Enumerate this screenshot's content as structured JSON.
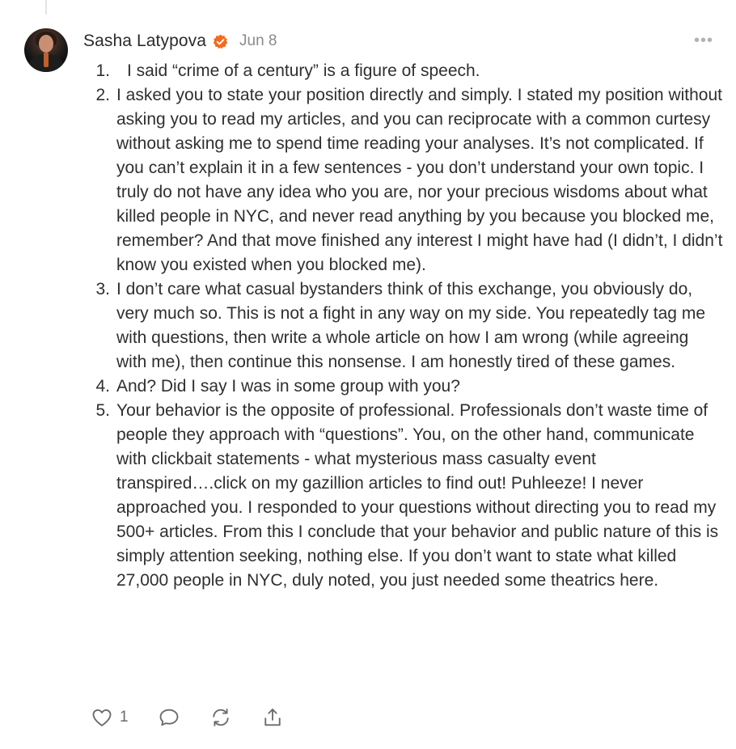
{
  "comment": {
    "author": "Sasha Latypova",
    "date": "Jun 8",
    "more_label": "•••",
    "items": [
      {
        "num": "1.",
        "text": "I said “crime of a century” is a figure of speech."
      },
      {
        "num": "2.",
        "text": "I asked you to state your position directly and simply. I stated my position without asking you to read my articles, and you can reciprocate with a common curtesy without asking me to spend time reading your analyses. It’s not complicated. If you can’t explain it in a few sentences - you don’t understand your own topic. I truly do not have any idea who you are, nor your precious wisdoms about what killed people in NYC, and never read anything by you because you blocked me, remember? And that move finished any interest I might have had (I didn’t, I didn’t know you existed when you blocked me)."
      },
      {
        "num": "3.",
        "text": "I don’t care what casual bystanders think of this exchange, you obviously do, very much so. This is not a fight in any way on my side. You repeatedly tag me with questions, then write a whole article on how I am wrong (while agreeing with me), then continue this nonsense. I am honestly tired of these games."
      },
      {
        "num": "4.",
        "text": "And? Did I say I was in some group with you?"
      },
      {
        "num": "5.",
        "text": "Your behavior is the opposite of professional. Professionals don’t waste time of people they approach with “questions”. You, on the other hand, communicate with clickbait statements - what mysterious mass casualty event transpired….click on my gazillion articles to find out! Puhleeze! I never approached you. I responded to your questions without directing you to read my 500+ articles. From this I conclude that your behavior and public nature of this is simply attention seeking, nothing else. If you don’t want to state what killed 27,000 people in NYC, duly noted, you just needed some theatrics here."
      }
    ],
    "like_count": "1"
  },
  "icons": {
    "verified": "verified-badge-icon",
    "like": "heart-icon",
    "reply": "comment-bubble-icon",
    "restack": "restack-icon",
    "share": "share-icon"
  },
  "colors": {
    "verified": "#f26a21",
    "text": "#2f2f2f",
    "muted": "#8a8a8a"
  }
}
